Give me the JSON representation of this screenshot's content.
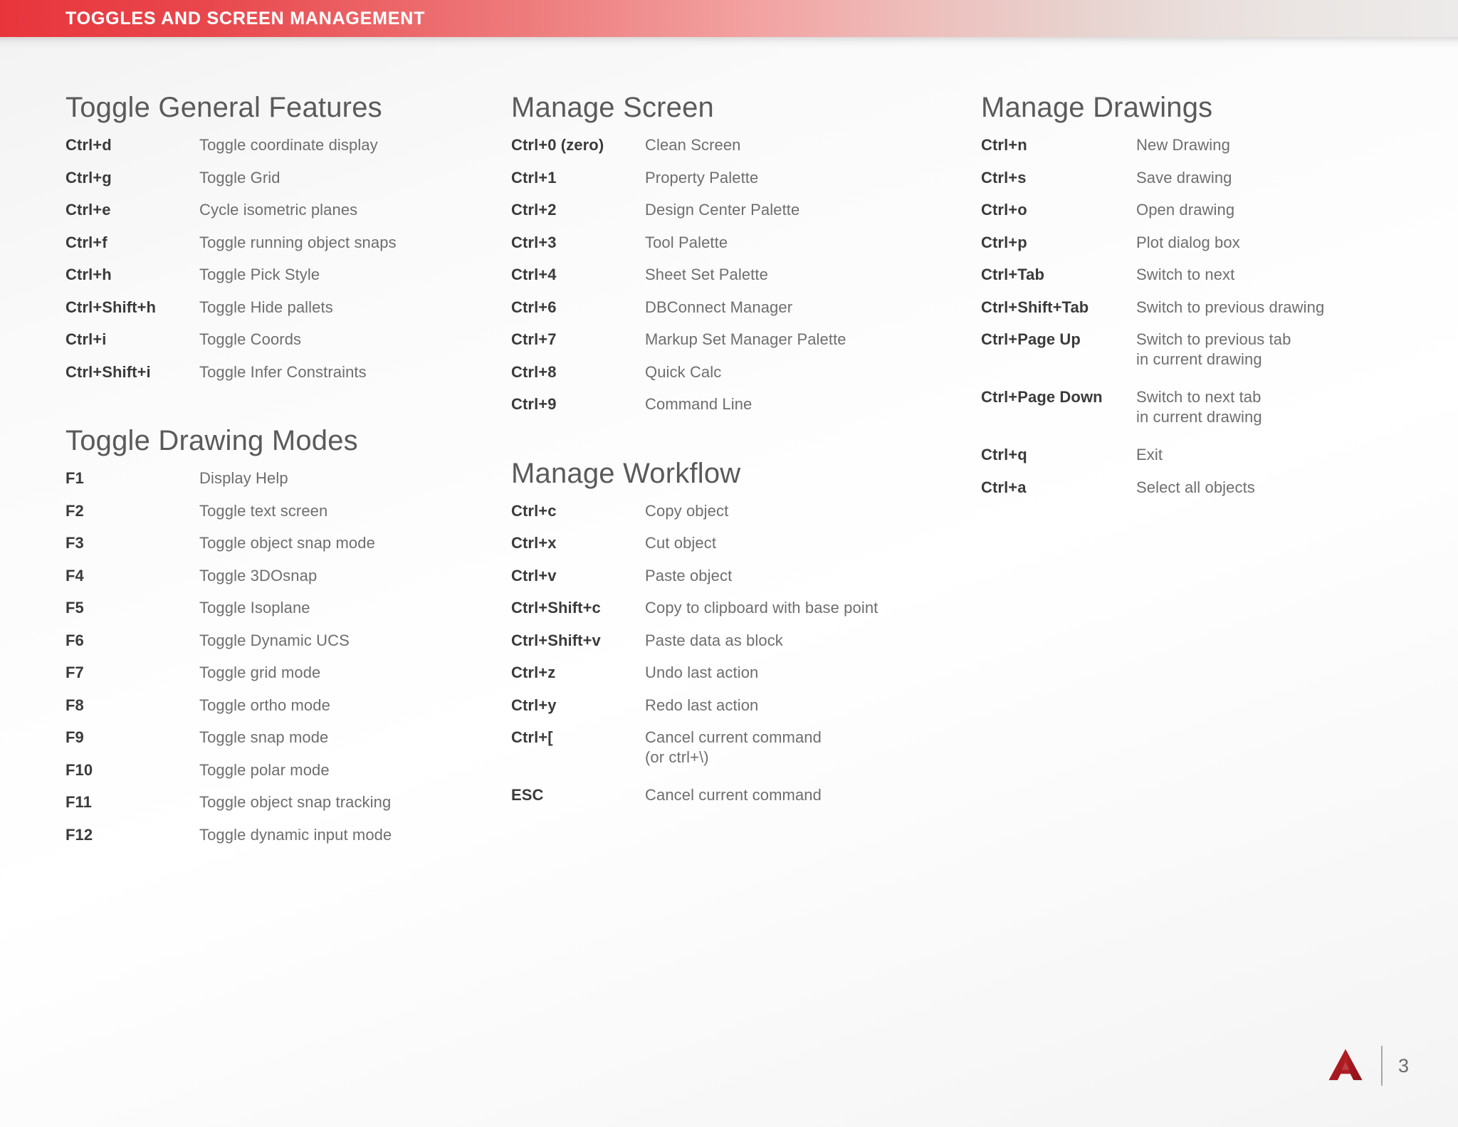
{
  "header": {
    "title": "TOGGLES AND SCREEN MANAGEMENT",
    "bar_start_color": "#e8353c",
    "bar_end_color": "#eceaea"
  },
  "columns": [
    {
      "sections": [
        {
          "title": "Toggle General Features",
          "rows": [
            {
              "key": "Ctrl+d",
              "desc": "Toggle coordinate display"
            },
            {
              "key": "Ctrl+g",
              "desc": "Toggle Grid"
            },
            {
              "key": "Ctrl+e",
              "desc": "Cycle isometric planes"
            },
            {
              "key": "Ctrl+f",
              "desc": "Toggle running object snaps"
            },
            {
              "key": "Ctrl+h",
              "desc": "Toggle Pick Style"
            },
            {
              "key": "Ctrl+Shift+h",
              "desc": "Toggle Hide pallets"
            },
            {
              "key": "Ctrl+i",
              "desc": "Toggle Coords"
            },
            {
              "key": "Ctrl+Shift+i",
              "desc": "Toggle Infer Constraints"
            }
          ]
        },
        {
          "title": "Toggle Drawing Modes",
          "rows": [
            {
              "key": "F1",
              "desc": "Display Help"
            },
            {
              "key": "F2",
              "desc": "Toggle text screen"
            },
            {
              "key": "F3",
              "desc": "Toggle object snap mode"
            },
            {
              "key": "F4",
              "desc": "Toggle 3DOsnap"
            },
            {
              "key": "F5",
              "desc": "Toggle Isoplane"
            },
            {
              "key": "F6",
              "desc": "Toggle Dynamic UCS"
            },
            {
              "key": "F7",
              "desc": "Toggle grid mode"
            },
            {
              "key": "F8",
              "desc": "Toggle ortho mode"
            },
            {
              "key": "F9",
              "desc": "Toggle snap mode"
            },
            {
              "key": "F10",
              "desc": "Toggle polar mode"
            },
            {
              "key": "F11",
              "desc": "Toggle object snap tracking"
            },
            {
              "key": "F12",
              "desc": "Toggle dynamic input mode"
            }
          ]
        }
      ]
    },
    {
      "sections": [
        {
          "title": "Manage Screen",
          "rows": [
            {
              "key": "Ctrl+0 (zero)",
              "desc": "Clean Screen"
            },
            {
              "key": "Ctrl+1",
              "desc": "Property Palette"
            },
            {
              "key": "Ctrl+2",
              "desc": "Design Center Palette"
            },
            {
              "key": "Ctrl+3",
              "desc": "Tool Palette"
            },
            {
              "key": "Ctrl+4",
              "desc": "Sheet Set Palette"
            },
            {
              "key": "Ctrl+6",
              "desc": "DBConnect Manager"
            },
            {
              "key": "Ctrl+7",
              "desc": "Markup Set Manager Palette"
            },
            {
              "key": "Ctrl+8",
              "desc": "Quick Calc"
            },
            {
              "key": "Ctrl+9",
              "desc": "Command Line"
            }
          ]
        },
        {
          "title": "Manage Workflow",
          "rows": [
            {
              "key": "Ctrl+c",
              "desc": "Copy object"
            },
            {
              "key": "Ctrl+x",
              "desc": "Cut object"
            },
            {
              "key": "Ctrl+v",
              "desc": "Paste object"
            },
            {
              "key": "Ctrl+Shift+c",
              "desc": "Copy to clipboard with base point"
            },
            {
              "key": "Ctrl+Shift+v",
              "desc": "Paste data as block"
            },
            {
              "key": "Ctrl+z",
              "desc": "Undo last action"
            },
            {
              "key": "Ctrl+y",
              "desc": "Redo last action"
            },
            {
              "key": "Ctrl+[",
              "desc": "Cancel current command\n(or ctrl+\\)"
            },
            {
              "key": "ESC",
              "desc": "Cancel current command"
            }
          ]
        }
      ]
    },
    {
      "sections": [
        {
          "title": "Manage Drawings",
          "rows": [
            {
              "key": "Ctrl+n",
              "desc": "New Drawing"
            },
            {
              "key": "Ctrl+s",
              "desc": "Save drawing"
            },
            {
              "key": "Ctrl+o",
              "desc": "Open drawing"
            },
            {
              "key": "Ctrl+p",
              "desc": "Plot dialog box"
            },
            {
              "key": "Ctrl+Tab",
              "desc": "Switch to next"
            },
            {
              "key": "Ctrl+Shift+Tab",
              "desc": "Switch to previous drawing"
            },
            {
              "key": "Ctrl+Page Up",
              "desc": "Switch to previous tab\nin current drawing"
            },
            {
              "key": "Ctrl+Page Down",
              "desc": "Switch to next tab\nin current drawing"
            },
            {
              "key": "Ctrl+q",
              "desc": "Exit"
            },
            {
              "key": "Ctrl+a",
              "desc": "Select all objects"
            }
          ]
        }
      ]
    }
  ],
  "footer": {
    "logo_name": "autocad-a-logo",
    "logo_color": "#b51b20",
    "page_number": "3"
  }
}
